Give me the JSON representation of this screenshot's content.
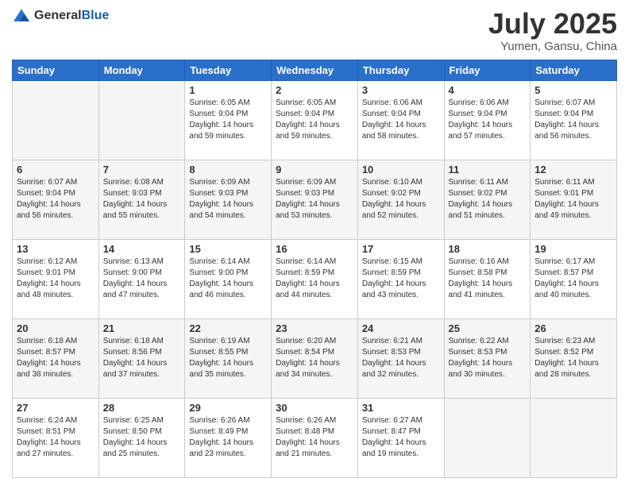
{
  "header": {
    "logo": {
      "general": "General",
      "blue": "Blue"
    },
    "title": "July 2025",
    "location": "Yumen, Gansu, China"
  },
  "weekdays": [
    "Sunday",
    "Monday",
    "Tuesday",
    "Wednesday",
    "Thursday",
    "Friday",
    "Saturday"
  ],
  "weeks": [
    [
      {
        "day": "",
        "sunrise": "",
        "sunset": "",
        "daylight": ""
      },
      {
        "day": "",
        "sunrise": "",
        "sunset": "",
        "daylight": ""
      },
      {
        "day": "1",
        "sunrise": "Sunrise: 6:05 AM",
        "sunset": "Sunset: 9:04 PM",
        "daylight": "Daylight: 14 hours and 59 minutes."
      },
      {
        "day": "2",
        "sunrise": "Sunrise: 6:05 AM",
        "sunset": "Sunset: 9:04 PM",
        "daylight": "Daylight: 14 hours and 59 minutes."
      },
      {
        "day": "3",
        "sunrise": "Sunrise: 6:06 AM",
        "sunset": "Sunset: 9:04 PM",
        "daylight": "Daylight: 14 hours and 58 minutes."
      },
      {
        "day": "4",
        "sunrise": "Sunrise: 6:06 AM",
        "sunset": "Sunset: 9:04 PM",
        "daylight": "Daylight: 14 hours and 57 minutes."
      },
      {
        "day": "5",
        "sunrise": "Sunrise: 6:07 AM",
        "sunset": "Sunset: 9:04 PM",
        "daylight": "Daylight: 14 hours and 56 minutes."
      }
    ],
    [
      {
        "day": "6",
        "sunrise": "Sunrise: 6:07 AM",
        "sunset": "Sunset: 9:04 PM",
        "daylight": "Daylight: 14 hours and 56 minutes."
      },
      {
        "day": "7",
        "sunrise": "Sunrise: 6:08 AM",
        "sunset": "Sunset: 9:03 PM",
        "daylight": "Daylight: 14 hours and 55 minutes."
      },
      {
        "day": "8",
        "sunrise": "Sunrise: 6:09 AM",
        "sunset": "Sunset: 9:03 PM",
        "daylight": "Daylight: 14 hours and 54 minutes."
      },
      {
        "day": "9",
        "sunrise": "Sunrise: 6:09 AM",
        "sunset": "Sunset: 9:03 PM",
        "daylight": "Daylight: 14 hours and 53 minutes."
      },
      {
        "day": "10",
        "sunrise": "Sunrise: 6:10 AM",
        "sunset": "Sunset: 9:02 PM",
        "daylight": "Daylight: 14 hours and 52 minutes."
      },
      {
        "day": "11",
        "sunrise": "Sunrise: 6:11 AM",
        "sunset": "Sunset: 9:02 PM",
        "daylight": "Daylight: 14 hours and 51 minutes."
      },
      {
        "day": "12",
        "sunrise": "Sunrise: 6:11 AM",
        "sunset": "Sunset: 9:01 PM",
        "daylight": "Daylight: 14 hours and 49 minutes."
      }
    ],
    [
      {
        "day": "13",
        "sunrise": "Sunrise: 6:12 AM",
        "sunset": "Sunset: 9:01 PM",
        "daylight": "Daylight: 14 hours and 48 minutes."
      },
      {
        "day": "14",
        "sunrise": "Sunrise: 6:13 AM",
        "sunset": "Sunset: 9:00 PM",
        "daylight": "Daylight: 14 hours and 47 minutes."
      },
      {
        "day": "15",
        "sunrise": "Sunrise: 6:14 AM",
        "sunset": "Sunset: 9:00 PM",
        "daylight": "Daylight: 14 hours and 46 minutes."
      },
      {
        "day": "16",
        "sunrise": "Sunrise: 6:14 AM",
        "sunset": "Sunset: 8:59 PM",
        "daylight": "Daylight: 14 hours and 44 minutes."
      },
      {
        "day": "17",
        "sunrise": "Sunrise: 6:15 AM",
        "sunset": "Sunset: 8:59 PM",
        "daylight": "Daylight: 14 hours and 43 minutes."
      },
      {
        "day": "18",
        "sunrise": "Sunrise: 6:16 AM",
        "sunset": "Sunset: 8:58 PM",
        "daylight": "Daylight: 14 hours and 41 minutes."
      },
      {
        "day": "19",
        "sunrise": "Sunrise: 6:17 AM",
        "sunset": "Sunset: 8:57 PM",
        "daylight": "Daylight: 14 hours and 40 minutes."
      }
    ],
    [
      {
        "day": "20",
        "sunrise": "Sunrise: 6:18 AM",
        "sunset": "Sunset: 8:57 PM",
        "daylight": "Daylight: 14 hours and 38 minutes."
      },
      {
        "day": "21",
        "sunrise": "Sunrise: 6:18 AM",
        "sunset": "Sunset: 8:56 PM",
        "daylight": "Daylight: 14 hours and 37 minutes."
      },
      {
        "day": "22",
        "sunrise": "Sunrise: 6:19 AM",
        "sunset": "Sunset: 8:55 PM",
        "daylight": "Daylight: 14 hours and 35 minutes."
      },
      {
        "day": "23",
        "sunrise": "Sunrise: 6:20 AM",
        "sunset": "Sunset: 8:54 PM",
        "daylight": "Daylight: 14 hours and 34 minutes."
      },
      {
        "day": "24",
        "sunrise": "Sunrise: 6:21 AM",
        "sunset": "Sunset: 8:53 PM",
        "daylight": "Daylight: 14 hours and 32 minutes."
      },
      {
        "day": "25",
        "sunrise": "Sunrise: 6:22 AM",
        "sunset": "Sunset: 8:53 PM",
        "daylight": "Daylight: 14 hours and 30 minutes."
      },
      {
        "day": "26",
        "sunrise": "Sunrise: 6:23 AM",
        "sunset": "Sunset: 8:52 PM",
        "daylight": "Daylight: 14 hours and 28 minutes."
      }
    ],
    [
      {
        "day": "27",
        "sunrise": "Sunrise: 6:24 AM",
        "sunset": "Sunset: 8:51 PM",
        "daylight": "Daylight: 14 hours and 27 minutes."
      },
      {
        "day": "28",
        "sunrise": "Sunrise: 6:25 AM",
        "sunset": "Sunset: 8:50 PM",
        "daylight": "Daylight: 14 hours and 25 minutes."
      },
      {
        "day": "29",
        "sunrise": "Sunrise: 6:26 AM",
        "sunset": "Sunset: 8:49 PM",
        "daylight": "Daylight: 14 hours and 23 minutes."
      },
      {
        "day": "30",
        "sunrise": "Sunrise: 6:26 AM",
        "sunset": "Sunset: 8:48 PM",
        "daylight": "Daylight: 14 hours and 21 minutes."
      },
      {
        "day": "31",
        "sunrise": "Sunrise: 6:27 AM",
        "sunset": "Sunset: 8:47 PM",
        "daylight": "Daylight: 14 hours and 19 minutes."
      },
      {
        "day": "",
        "sunrise": "",
        "sunset": "",
        "daylight": ""
      },
      {
        "day": "",
        "sunrise": "",
        "sunset": "",
        "daylight": ""
      }
    ]
  ]
}
